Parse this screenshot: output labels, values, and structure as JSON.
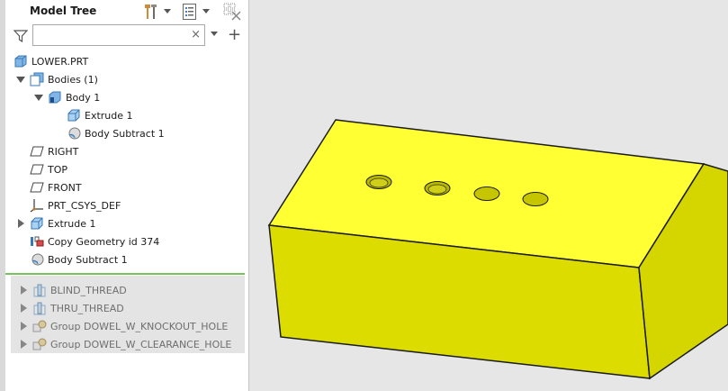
{
  "panel": {
    "title": "Model Tree"
  },
  "search": {
    "value": "",
    "placeholder": "",
    "clear_glyph": "×"
  },
  "add_glyph": "+",
  "tree": {
    "root": "LOWER.PRT",
    "bodies": "Bodies (1)",
    "body1": "Body 1",
    "body1_extrude": "Extrude 1",
    "body1_subtract": "Body Subtract 1",
    "right": "RIGHT",
    "top": "TOP",
    "front": "FRONT",
    "csys": "PRT_CSYS_DEF",
    "extrude": "Extrude 1",
    "copy_geom": "Copy Geometry id 374",
    "body_subtract": "Body Subtract 1",
    "blind_thread": "BLIND_THREAD",
    "thru_thread": "THRU_THREAD",
    "group_knockout": "Group DOWEL_W_KNOCKOUT_HOLE",
    "group_clearance": "Group DOWEL_W_CLEARANCE_HOLE"
  },
  "colors": {
    "part_yellow": "#ffff33",
    "active_green": "#79c05f",
    "viewport_bg": "#e6e6e6"
  }
}
